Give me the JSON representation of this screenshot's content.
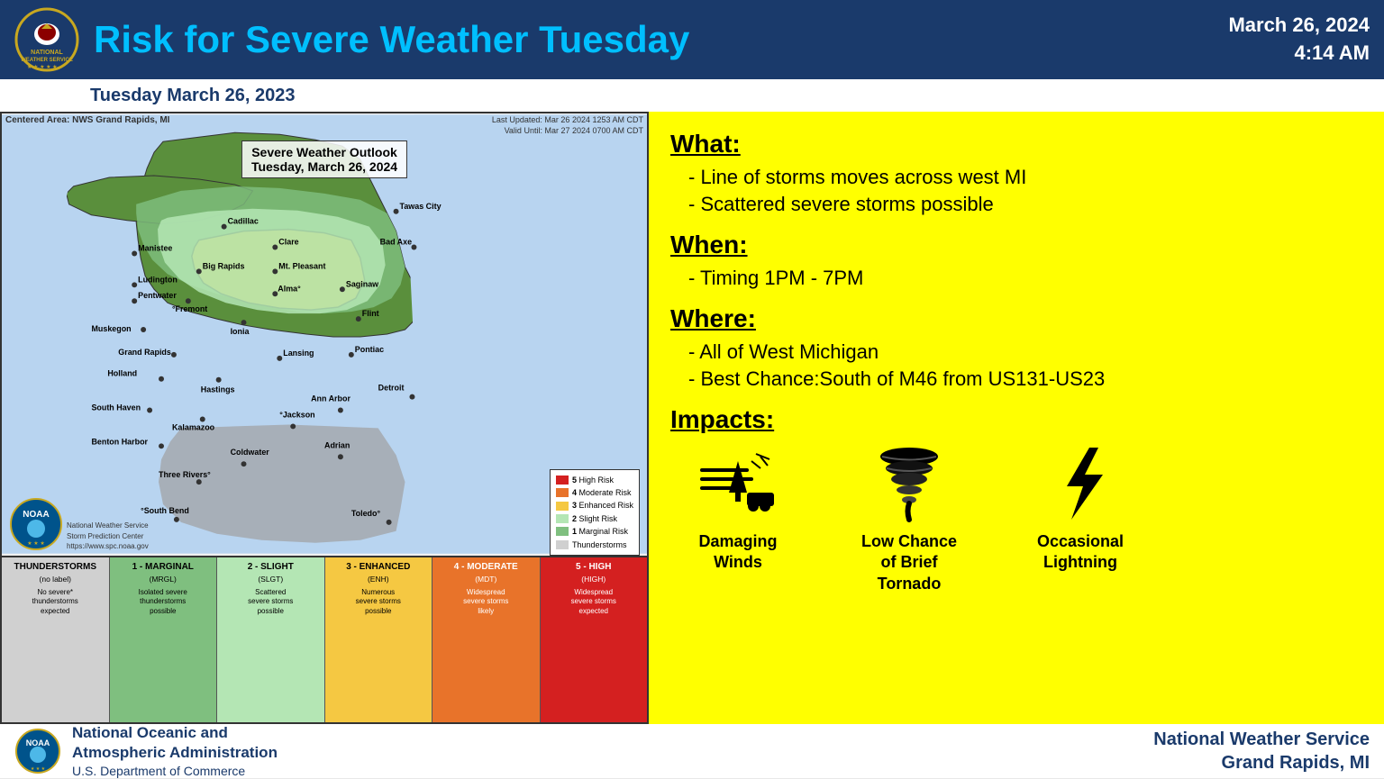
{
  "header": {
    "title": "Risk for Severe Weather Tuesday",
    "date": "March 26, 2024",
    "time": "4:14 AM"
  },
  "sub_header": {
    "date": "Tuesday March 26, 2023"
  },
  "map": {
    "centered_area": "Centered Area: NWS Grand Rapids, MI",
    "last_updated": "Last Updated: Mar 26 2024 1253 AM CDT",
    "valid_until": "Valid Until: Mar 27 2024 0700 AM CDT",
    "outlook_title_line1": "Severe Weather Outlook",
    "outlook_title_line2": "Tuesday, March 26, 2024",
    "cities": [
      "Manistee",
      "Cadillac",
      "Tawas City",
      "Ludington",
      "Clare",
      "Pentwater",
      "Big Rapids",
      "Mt. Pleasant",
      "Bad Axe",
      "Fremont",
      "Alma",
      "Saginaw",
      "Muskegon",
      "Ionia",
      "Flint",
      "Grand Rapids",
      "Lansing",
      "Holland",
      "Hastings",
      "Pontiac",
      "South Haven",
      "Kalamazoo",
      "Ann Arbor",
      "Detroit",
      "Benton Harbor",
      "Jackson",
      "Coldwater",
      "Adrian",
      "Three Rivers",
      "South Bend",
      "Toledo"
    ],
    "attribution_line1": "National Weather Service",
    "attribution_line2": "Storm Prediction Center",
    "attribution_url": "https://www.spc.noaa.gov"
  },
  "risk_legend": {
    "items": [
      {
        "label": "High Risk",
        "color": "#d42020",
        "num": "5"
      },
      {
        "label": "Moderate Risk",
        "color": "#e8732a",
        "num": "4"
      },
      {
        "label": "Enhanced Risk",
        "color": "#f5c842",
        "num": "3"
      },
      {
        "label": "Slight Risk",
        "color": "#b4e6b4",
        "num": "2"
      },
      {
        "label": "Marginal Risk",
        "color": "#7fbf7f",
        "num": "1"
      },
      {
        "label": "Thunderstorms",
        "color": "#d0d0d0",
        "num": ""
      }
    ]
  },
  "risk_bar": {
    "columns": [
      {
        "header": "THUNDERSTORMS",
        "sub": "(no label)",
        "desc": "No severe*\nthunderstorms\nexpected",
        "bg": "#d0d0d0",
        "text": "#000"
      },
      {
        "header": "1 - MARGINAL",
        "sub": "(MRGL)",
        "desc": "Isolated severe\nthunderstorms\npossible",
        "bg": "#7fbf7f",
        "text": "#000"
      },
      {
        "header": "2 - SLIGHT",
        "sub": "(SLGT)",
        "desc": "Scattered\nsevere storms\npossible",
        "bg": "#b4e6b4",
        "text": "#000"
      },
      {
        "header": "3 - ENHANCED",
        "sub": "(ENH)",
        "desc": "Numerous\nsevere storms\npossible",
        "bg": "#f5c842",
        "text": "#000"
      },
      {
        "header": "4 - MODERATE",
        "sub": "(MDT)",
        "desc": "Widespread\nsevere storms\nlikely",
        "bg": "#e8732a",
        "text": "#fff"
      },
      {
        "header": "5 - HIGH",
        "sub": "(HIGH)",
        "desc": "Widespread\nsevere storms\nexpected",
        "bg": "#d42020",
        "text": "#fff"
      }
    ]
  },
  "info": {
    "what_title": "What:",
    "what_items": [
      "Line of storms moves across west MI",
      "Scattered severe storms possible"
    ],
    "when_title": "When:",
    "when_items": [
      "Timing 1PM - 7PM"
    ],
    "where_title": "Where:",
    "where_items": [
      "All of West Michigan",
      "Best Chance:South of M46 from US131-US23"
    ],
    "impacts_title": "Impacts:",
    "impacts": [
      {
        "label": "Damaging\nWinds",
        "icon": "wind"
      },
      {
        "label": "Low Chance\nof Brief\nTornado",
        "icon": "tornado"
      },
      {
        "label": "Occasional\nLightning",
        "icon": "lightning"
      }
    ]
  },
  "footer": {
    "org_name": "National Oceanic and",
    "org_name2": "Atmospheric Administration",
    "org_sub": "U.S. Department of Commerce",
    "nws_name": "National Weather Service",
    "nws_location": "Grand Rapids, MI"
  }
}
